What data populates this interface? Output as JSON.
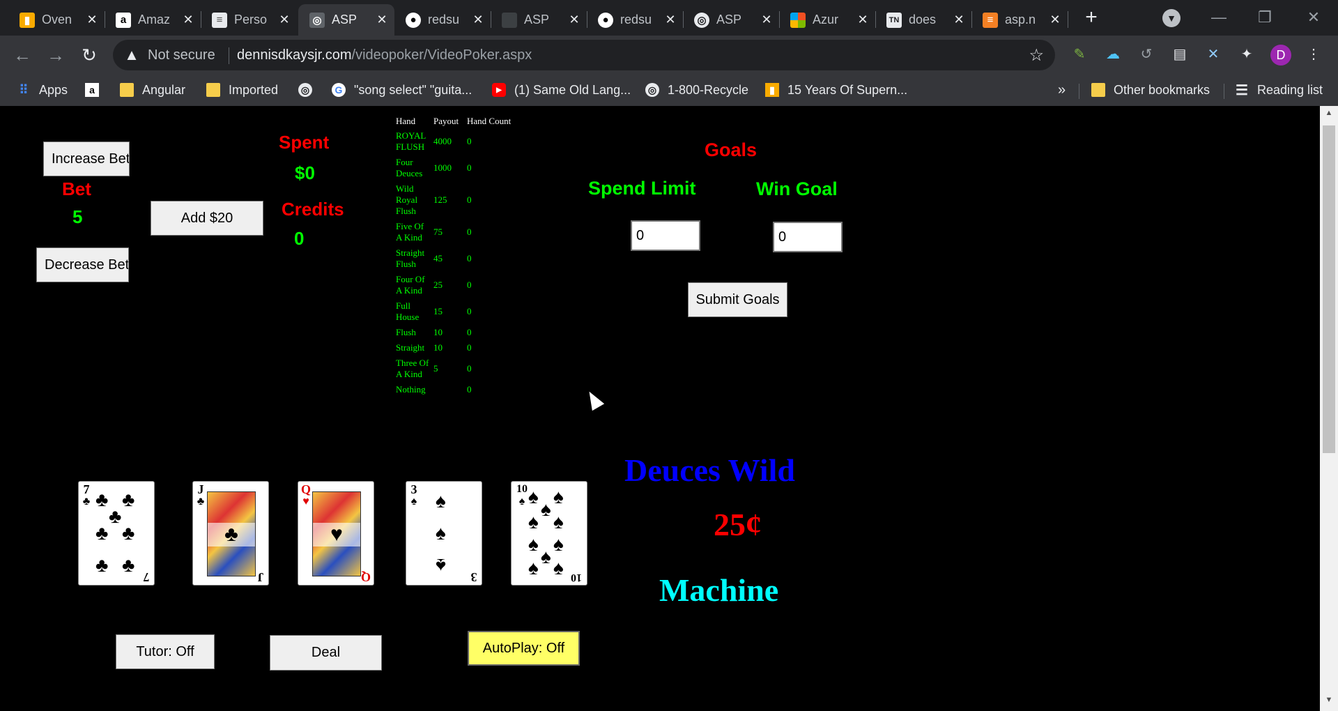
{
  "browser": {
    "tabs": [
      {
        "title": "Oven",
        "icon": "gift-icon",
        "active": false
      },
      {
        "title": "Amaz",
        "icon": "amazon-icon",
        "active": false
      },
      {
        "title": "Perso",
        "icon": "document-icon",
        "active": false
      },
      {
        "title": "ASP",
        "icon": "globe-icon",
        "active": true
      },
      {
        "title": "redsu",
        "icon": "github-icon",
        "active": false
      },
      {
        "title": "ASP",
        "icon": "globe-icon",
        "active": false
      },
      {
        "title": "redsu",
        "icon": "github-icon",
        "active": false
      },
      {
        "title": "ASP",
        "icon": "globe-icon",
        "active": false
      },
      {
        "title": "Azur",
        "icon": "microsoft-icon",
        "active": false
      },
      {
        "title": "does",
        "icon": "tn-icon",
        "active": false
      },
      {
        "title": "asp.n",
        "icon": "stackoverflow-icon",
        "active": false
      }
    ],
    "address": {
      "security": "Not secure",
      "host": "dennisdkaysjr.com",
      "path": "/videopoker/VideoPoker.aspx"
    },
    "bookmarks": [
      {
        "label": "Apps",
        "icon": "apps-grid-icon"
      },
      {
        "label": "",
        "icon": "amazon-icon"
      },
      {
        "label": "Angular",
        "icon": "folder-icon"
      },
      {
        "label": "Imported",
        "icon": "folder-icon"
      },
      {
        "label": "",
        "icon": "globe-icon"
      },
      {
        "label": "\"song select\" \"guita...",
        "icon": "google-icon"
      },
      {
        "label": "(1) Same Old Lang...",
        "icon": "youtube-icon"
      },
      {
        "label": "1-800-Recycle",
        "icon": "globe-icon"
      },
      {
        "label": "15 Years Of Supern...",
        "icon": "gift-icon"
      }
    ],
    "overflow": "»",
    "other_bookmarks": "Other bookmarks",
    "reading_list": "Reading list",
    "avatar_letter": "D"
  },
  "game": {
    "increase_bet": "Increase Bet",
    "decrease_bet": "Decrease Bet",
    "bet_label": "Bet",
    "bet_value": "5",
    "add_money": "Add $20",
    "spent_label": "Spent",
    "spent_value": "$0",
    "credits_label": "Credits",
    "credits_value": "0",
    "paytable": {
      "headers": [
        "Hand",
        "Payout",
        "Hand Count"
      ],
      "rows": [
        {
          "hand": "ROYAL FLUSH",
          "payout": "4000",
          "count": "0"
        },
        {
          "hand": "Four Deuces",
          "payout": "1000",
          "count": "0"
        },
        {
          "hand": "Wild Royal Flush",
          "payout": "125",
          "count": "0"
        },
        {
          "hand": "Five Of A Kind",
          "payout": "75",
          "count": "0"
        },
        {
          "hand": "Straight Flush",
          "payout": "45",
          "count": "0"
        },
        {
          "hand": "Four Of A Kind",
          "payout": "25",
          "count": "0"
        },
        {
          "hand": "Full House",
          "payout": "15",
          "count": "0"
        },
        {
          "hand": "Flush",
          "payout": "10",
          "count": "0"
        },
        {
          "hand": "Straight",
          "payout": "10",
          "count": "0"
        },
        {
          "hand": "Three Of A Kind",
          "payout": "5",
          "count": "0"
        },
        {
          "hand": "Nothing",
          "payout": "",
          "count": "0"
        }
      ]
    },
    "goals": {
      "title": "Goals",
      "spend_limit_label": "Spend Limit",
      "win_goal_label": "Win Goal",
      "spend_limit_value": "0",
      "win_goal_value": "0",
      "submit": "Submit Goals"
    },
    "cards": [
      {
        "rank": "7",
        "suit": "♣",
        "color": "black",
        "type": "pips"
      },
      {
        "rank": "J",
        "suit": "♣",
        "color": "black",
        "type": "face"
      },
      {
        "rank": "Q",
        "suit": "♥",
        "color": "red",
        "type": "face"
      },
      {
        "rank": "3",
        "suit": "♠",
        "color": "black",
        "type": "pips"
      },
      {
        "rank": "10",
        "suit": "♠",
        "color": "black",
        "type": "pips"
      }
    ],
    "machine_title_1": "Deuces Wild",
    "machine_title_2": "25¢",
    "machine_title_3": "Machine",
    "tutor": "Tutor: Off",
    "deal": "Deal",
    "autoplay": "AutoPlay: Off"
  }
}
